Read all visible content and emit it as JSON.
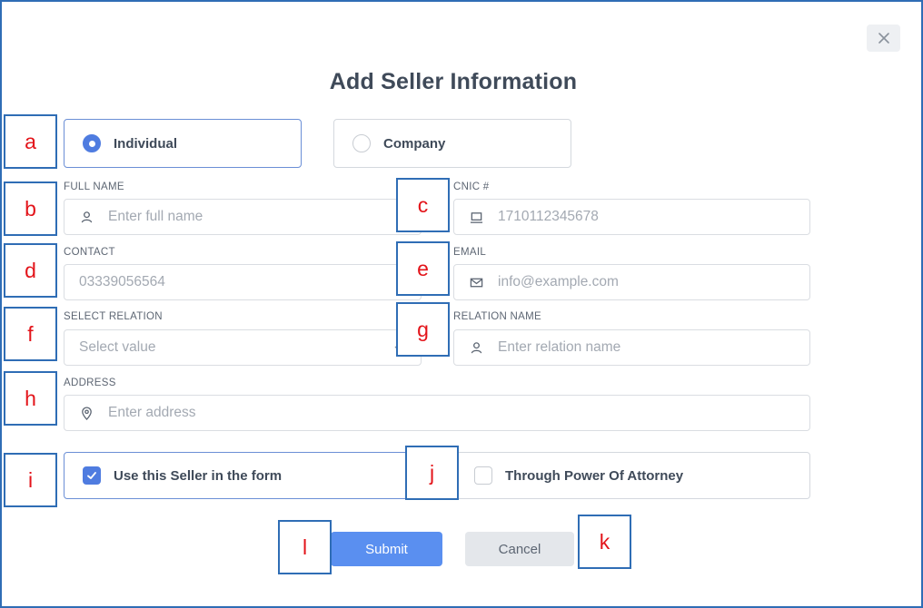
{
  "dialog": {
    "title": "Add Seller Information",
    "close_icon": "close-icon"
  },
  "seller_type": {
    "options": [
      {
        "label": "Individual",
        "checked": true
      },
      {
        "label": "Company",
        "checked": false
      }
    ]
  },
  "fields": {
    "full_name": {
      "label": "FULL NAME",
      "placeholder": "Enter full name",
      "icon": "user-icon"
    },
    "cnic": {
      "label": "CNIC #",
      "placeholder": "1710112345678",
      "icon": "id-card-icon"
    },
    "contact": {
      "label": "CONTACT",
      "placeholder": "03339056564"
    },
    "email": {
      "label": "EMAIL",
      "placeholder": "info@example.com",
      "icon": "mail-icon"
    },
    "relation": {
      "label": "SELECT RELATION",
      "placeholder": "Select value",
      "icon": "chevron-down-icon"
    },
    "relation_name": {
      "label": "RELATION NAME",
      "placeholder": "Enter relation name",
      "icon": "user-icon"
    },
    "address": {
      "label": "ADDRESS",
      "placeholder": "Enter address",
      "icon": "location-pin-icon"
    }
  },
  "checks": {
    "use_seller": {
      "label": "Use this Seller in the form",
      "checked": true
    },
    "power_of_attorney": {
      "label": "Through Power Of Attorney",
      "checked": false
    }
  },
  "buttons": {
    "submit": "Submit",
    "cancel": "Cancel"
  },
  "annotations": {
    "a": "a",
    "b": "b",
    "c": "c",
    "d": "d",
    "e": "e",
    "f": "f",
    "g": "g",
    "h": "h",
    "i": "i",
    "j": "j",
    "k": "k",
    "l": "l"
  },
  "colors": {
    "accent": "#4f7ce0",
    "submit_bg": "#5a8ff0",
    "annotation_border": "#2f6db5",
    "annotation_text": "#e3141a"
  }
}
